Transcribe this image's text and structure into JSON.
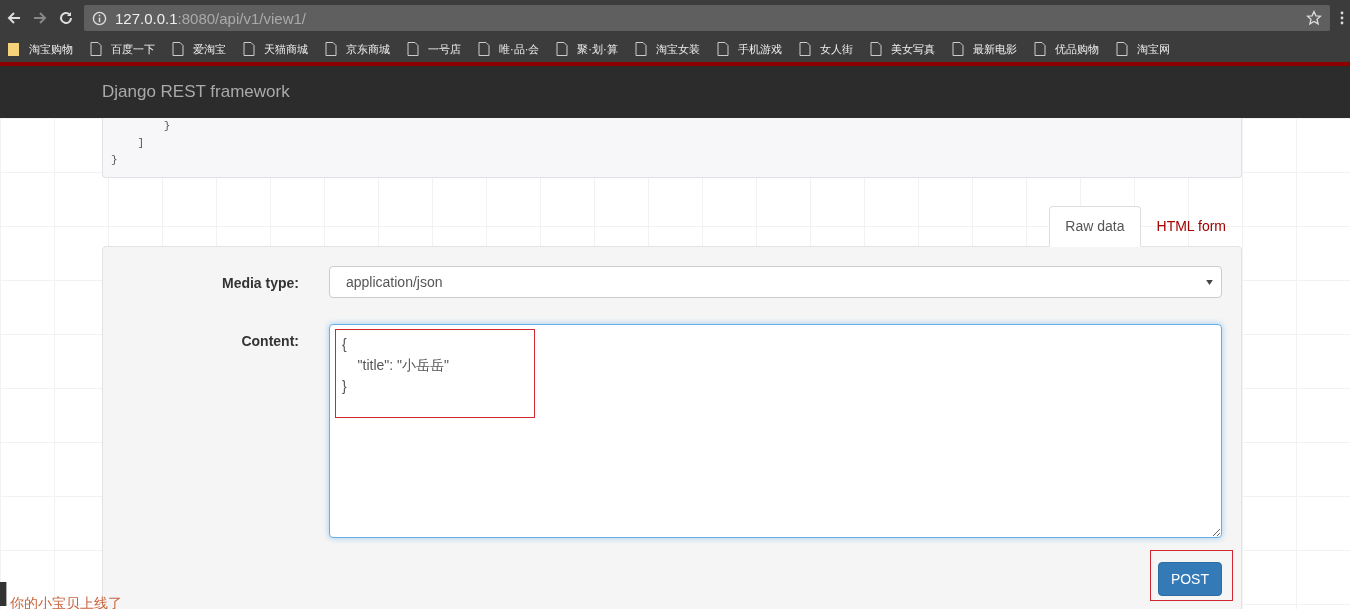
{
  "browser": {
    "url_host": "127.0.0.1",
    "url_rest": ":8080/api/v1/view1/",
    "bookmarks": [
      {
        "label": "淘宝购物",
        "kind": "folder"
      },
      {
        "label": "百度一下",
        "kind": "page"
      },
      {
        "label": "爱淘宝",
        "kind": "page"
      },
      {
        "label": "天猫商城",
        "kind": "page"
      },
      {
        "label": "京东商城",
        "kind": "page"
      },
      {
        "label": "一号店",
        "kind": "page"
      },
      {
        "label": "唯·品·会",
        "kind": "page"
      },
      {
        "label": "聚·划·算",
        "kind": "page"
      },
      {
        "label": "淘宝女装",
        "kind": "page"
      },
      {
        "label": "手机游戏",
        "kind": "page"
      },
      {
        "label": "女人街",
        "kind": "page"
      },
      {
        "label": "美女写真",
        "kind": "page"
      },
      {
        "label": "最新电影",
        "kind": "page"
      },
      {
        "label": "优品购物",
        "kind": "page"
      },
      {
        "label": "淘宝网",
        "kind": "page"
      }
    ]
  },
  "navbar": {
    "brand": "Django REST framework"
  },
  "response": {
    "lines": [
      "        }",
      "    ]",
      "}"
    ]
  },
  "tabs": [
    {
      "label": "Raw data",
      "selected": true
    },
    {
      "label": "HTML form",
      "selected": false
    }
  ],
  "form": {
    "media_type": {
      "label": "Media type:",
      "value": "application/json"
    },
    "content": {
      "label": "Content:",
      "value": "{\n    \"title\": \"小岳岳\"\n}",
      "highlighted": true
    },
    "submit": {
      "label": "POST",
      "highlighted": true
    }
  },
  "overlay_note": "你的小宝贝上线了"
}
